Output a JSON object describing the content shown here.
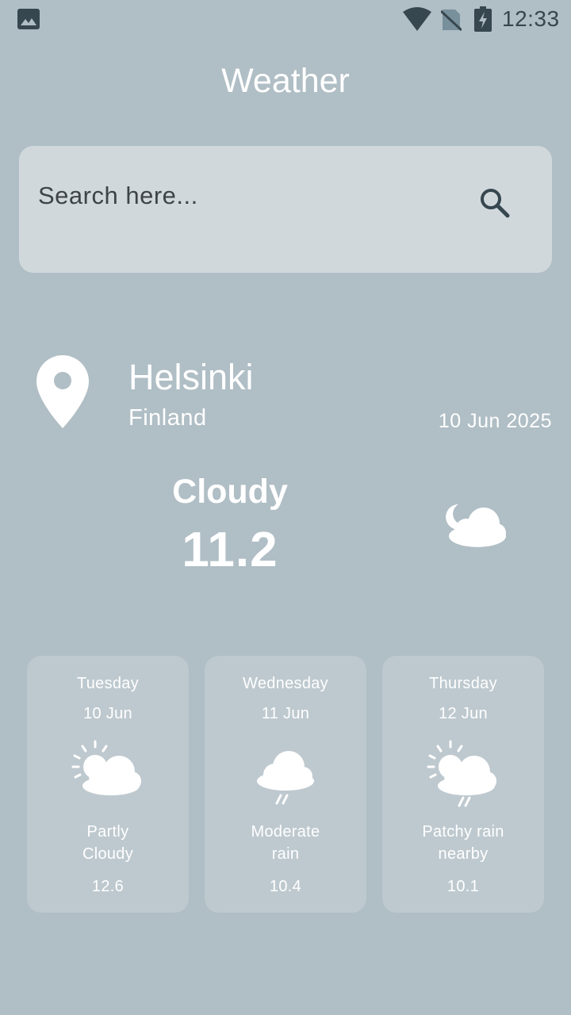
{
  "status_bar": {
    "time": "12:33",
    "icons": [
      "gallery-icon",
      "wifi-icon",
      "no-sim-icon",
      "battery-charging-icon"
    ]
  },
  "app": {
    "title": "Weather"
  },
  "search": {
    "placeholder": "Search here...",
    "value": "",
    "icon": "search-icon"
  },
  "location": {
    "city": "Helsinki",
    "country": "Finland",
    "date": "10 Jun 2025",
    "icon": "location-pin-icon"
  },
  "current": {
    "condition": "Cloudy",
    "temperature": "11.2",
    "icon": "cloudy-night-icon"
  },
  "forecast": [
    {
      "day": "Tuesday",
      "date": "10 Jun",
      "condition": "Partly\nCloudy",
      "temperature": "12.6",
      "icon": "partly-cloudy-icon"
    },
    {
      "day": "Wednesday",
      "date": "11 Jun",
      "condition": "Moderate\nrain",
      "temperature": "10.4",
      "icon": "rain-cloud-icon"
    },
    {
      "day": "Thursday",
      "date": "12 Jun",
      "condition": "Patchy rain\nnearby",
      "temperature": "10.1",
      "icon": "sun-cloud-rain-icon"
    }
  ],
  "colors": {
    "background": "#b0bec5",
    "search_bg": "#d1d8dc",
    "text": "#ffffff",
    "status_icons": "#37474f"
  }
}
